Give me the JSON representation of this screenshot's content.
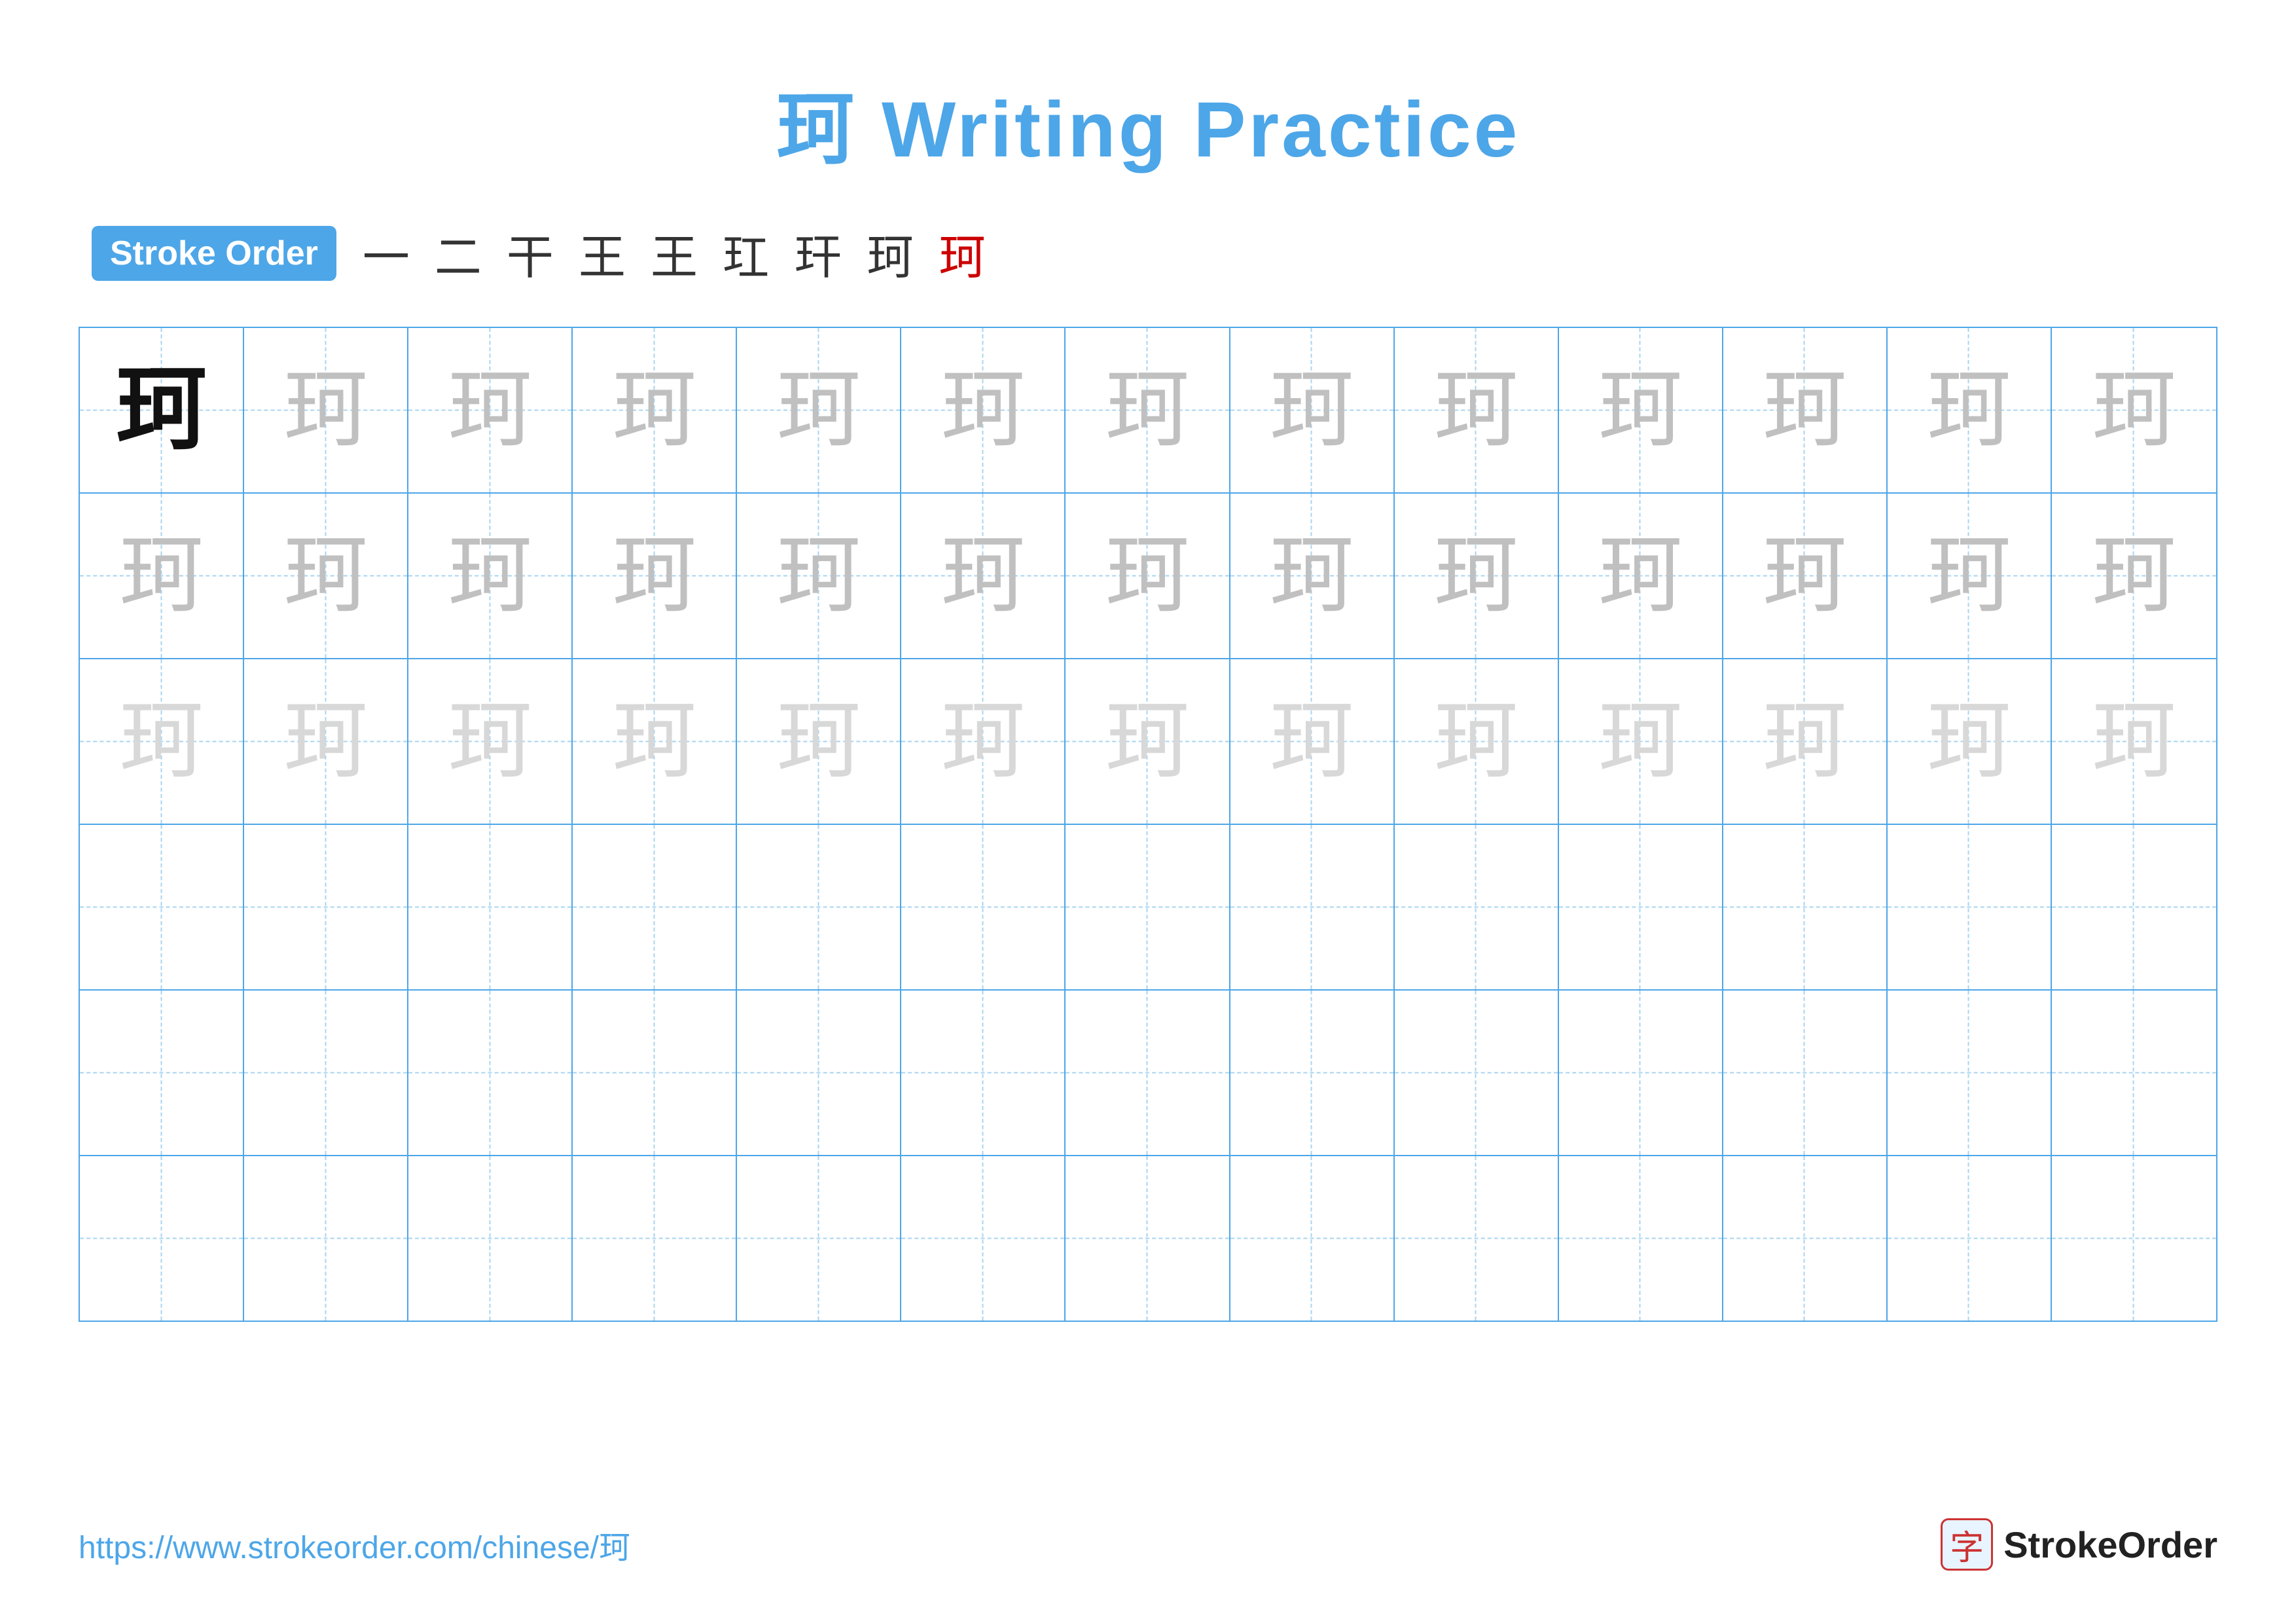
{
  "title": {
    "character": "珂",
    "rest": " Writing Practice",
    "full": "珂 Writing Practice"
  },
  "stroke_order": {
    "badge_label": "Stroke Order",
    "steps": [
      "一",
      "二",
      "干",
      "王",
      "王",
      "玒",
      "玕",
      "珂",
      "珂"
    ]
  },
  "grid": {
    "rows": 6,
    "cols": 13,
    "character": "珂",
    "row_types": [
      "dark-then-medium",
      "medium",
      "light",
      "empty",
      "empty",
      "empty"
    ]
  },
  "footer": {
    "url": "https://www.strokeorder.com/chinese/珂",
    "logo_char": "字",
    "logo_text": "StrokeOrder"
  }
}
